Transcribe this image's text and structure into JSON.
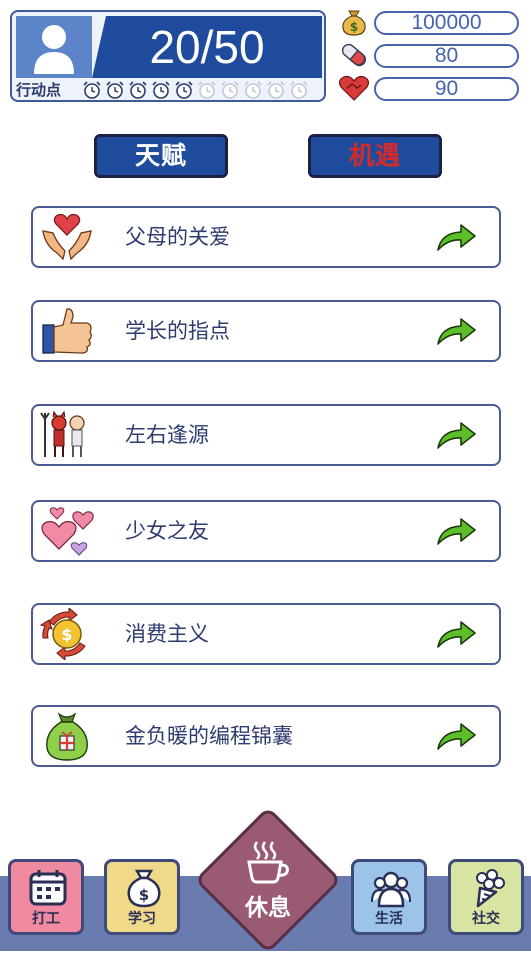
{
  "status": {
    "action_points": "20/50",
    "action_label": "行动点",
    "clocks_filled": 5,
    "clocks_total": 10
  },
  "resources": [
    {
      "icon": "money-bag-icon",
      "value": "100000"
    },
    {
      "icon": "pill-capsule-icon",
      "value": "80"
    },
    {
      "icon": "heart-handshake-icon",
      "value": "90"
    }
  ],
  "tabs": {
    "talent": "天赋",
    "chance": "机遇"
  },
  "items": [
    {
      "label": "父母的关爱",
      "icon": "heart-hands-icon"
    },
    {
      "label": "学长的指点",
      "icon": "thumbs-up-icon"
    },
    {
      "label": "左右逢源",
      "icon": "devil-angel-icon"
    },
    {
      "label": "少女之友",
      "icon": "hearts-icon"
    },
    {
      "label": "消费主义",
      "icon": "coin-cycle-icon"
    },
    {
      "label": "金负暖的编程锦囊",
      "icon": "gift-bag-icon"
    }
  ],
  "nav": {
    "work": "打工",
    "study": "学习",
    "rest": "休息",
    "life": "生活",
    "social": "社交"
  },
  "colors": {
    "primary_blue": "#1f4b9c",
    "chance_red": "#d42a2a",
    "arrow_green": "#5cbf2a",
    "rest_button": "#9a5a73"
  }
}
